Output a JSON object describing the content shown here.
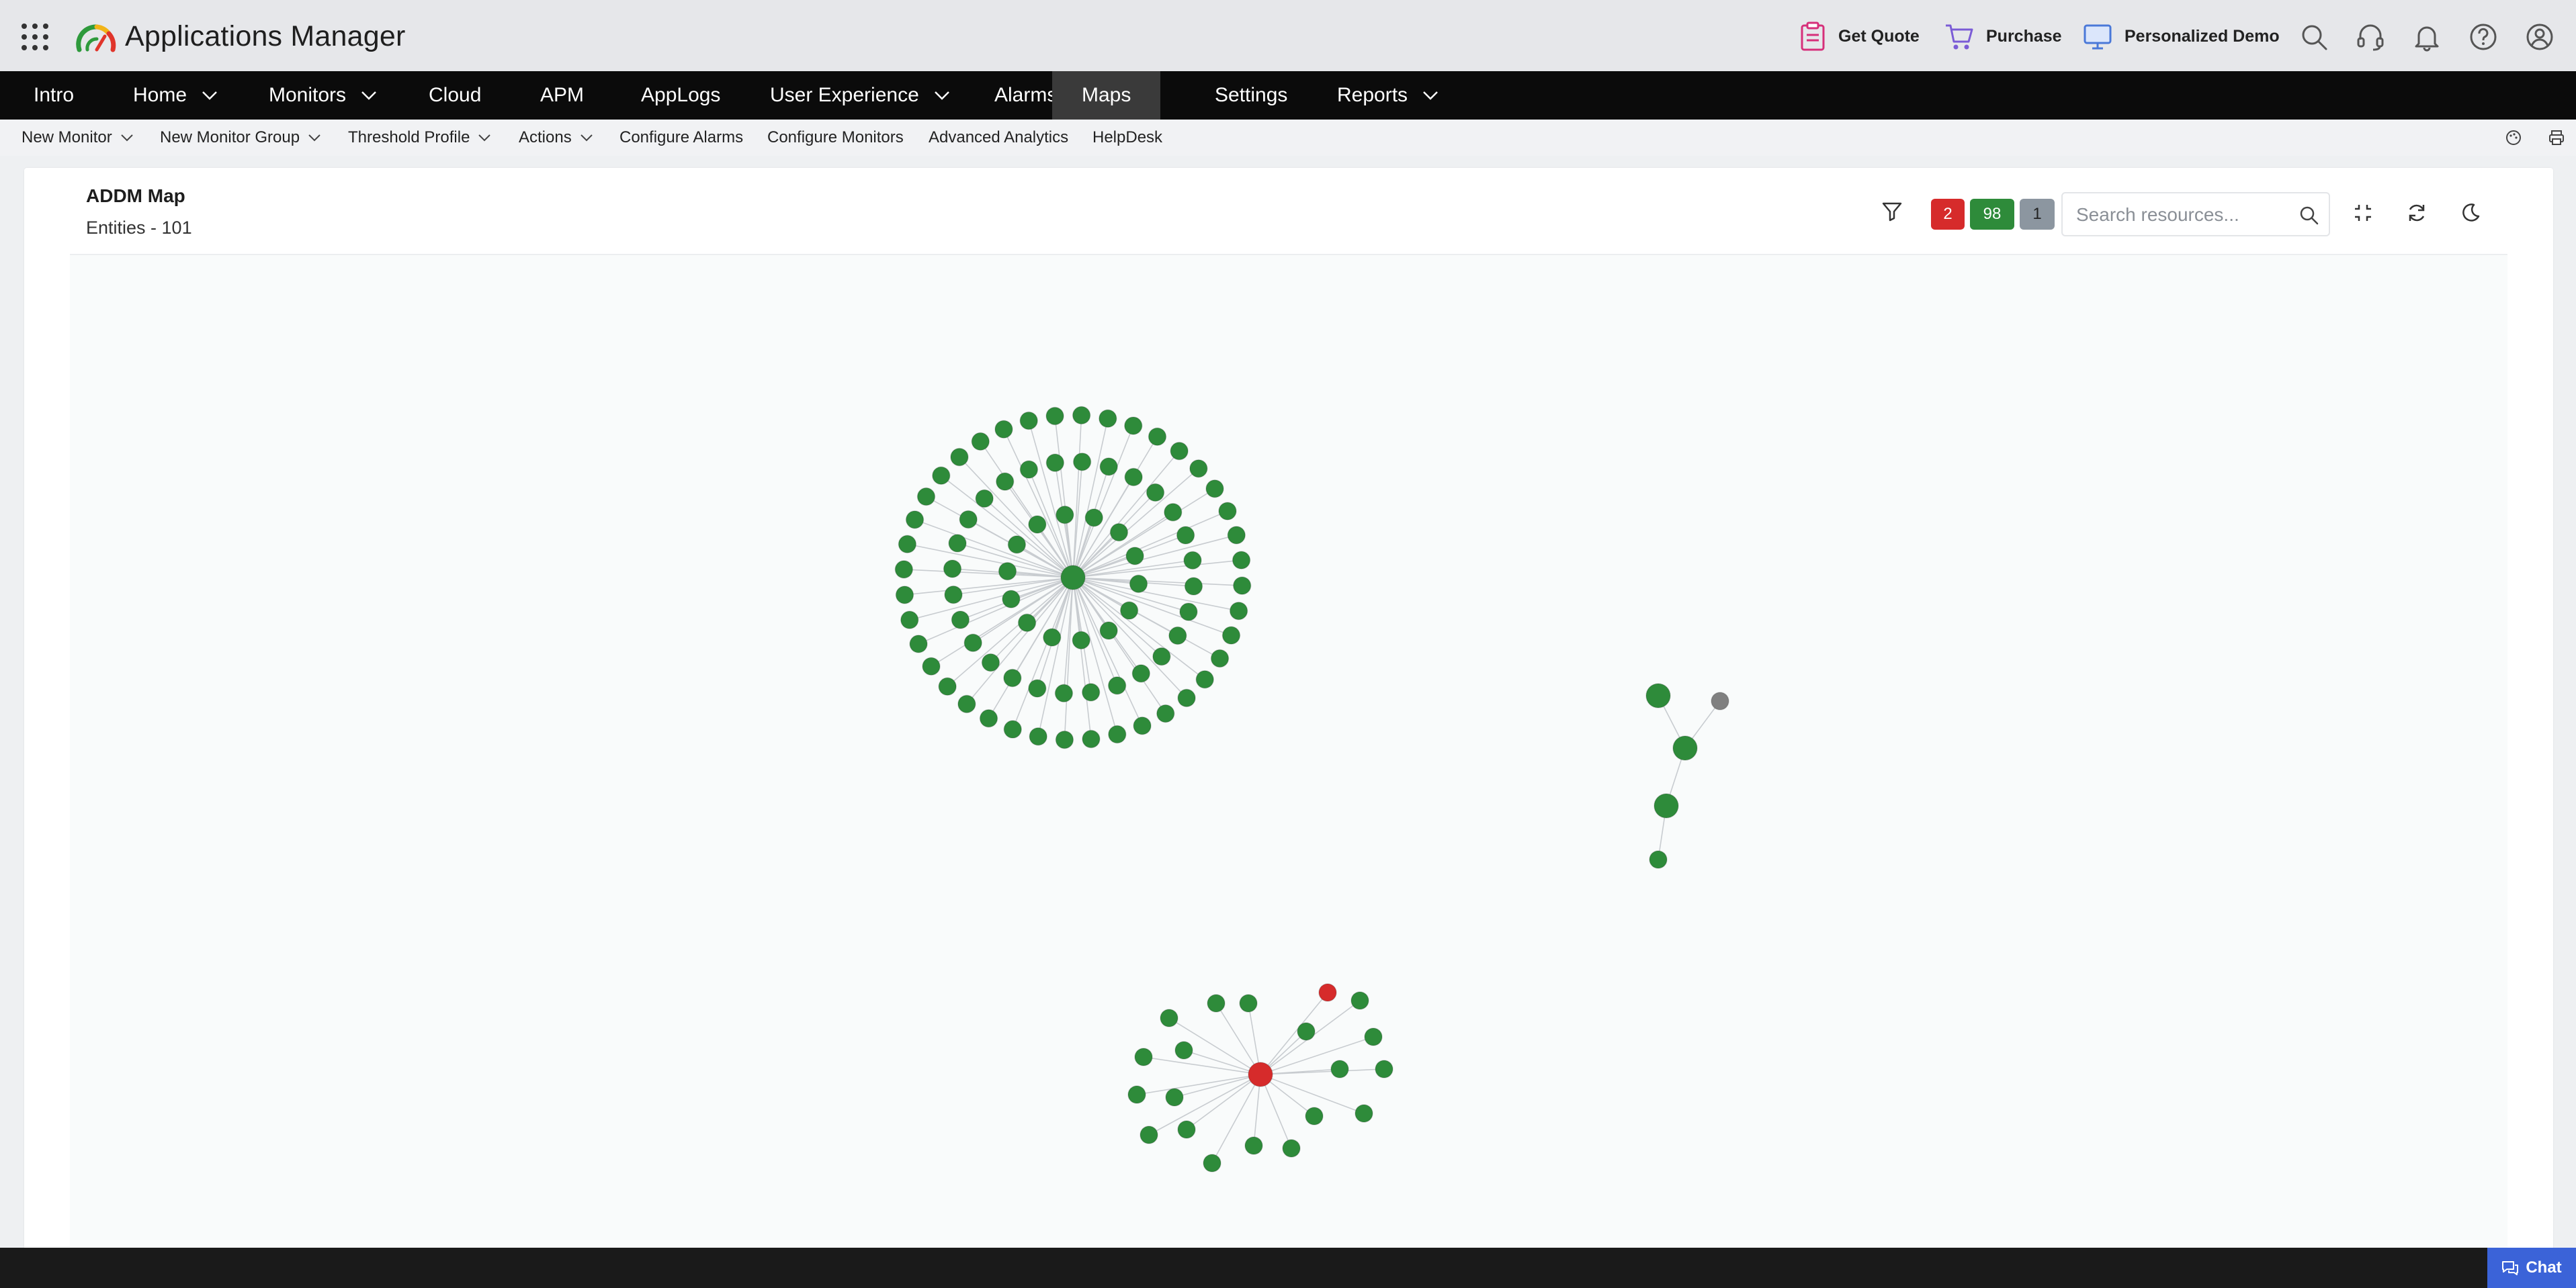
{
  "app": {
    "title": "Applications Manager",
    "grid_icon": "apps-grid-icon",
    "logo_icon": "gauge-logo-icon"
  },
  "top_actions": [
    {
      "label": "Get Quote",
      "icon": "clipboard-icon",
      "color": "#d62f7a"
    },
    {
      "label": "Purchase",
      "icon": "cart-icon",
      "color": "#7b5cd6"
    },
    {
      "label": "Personalized Demo",
      "icon": "monitor-icon",
      "color": "#4a78d8"
    }
  ],
  "top_icons": [
    "search-icon",
    "headset-icon",
    "bell-icon",
    "help-icon",
    "user-icon"
  ],
  "main_nav": [
    {
      "label": "Intro",
      "dropdown": false,
      "active": false
    },
    {
      "label": "Home",
      "dropdown": true,
      "active": false
    },
    {
      "label": "Monitors",
      "dropdown": true,
      "active": false
    },
    {
      "label": "Cloud",
      "dropdown": false,
      "active": false
    },
    {
      "label": "APM",
      "dropdown": false,
      "active": false
    },
    {
      "label": "AppLogs",
      "dropdown": false,
      "active": false
    },
    {
      "label": "User Experience",
      "dropdown": true,
      "active": false
    },
    {
      "label": "Alarms",
      "dropdown": false,
      "active": false
    },
    {
      "label": "Maps",
      "dropdown": false,
      "active": true
    },
    {
      "label": "Settings",
      "dropdown": false,
      "active": false
    },
    {
      "label": "Reports",
      "dropdown": true,
      "active": false
    }
  ],
  "sub_nav": [
    {
      "label": "New Monitor",
      "dropdown": true
    },
    {
      "label": "New Monitor Group",
      "dropdown": true
    },
    {
      "label": "Threshold Profile",
      "dropdown": true
    },
    {
      "label": "Actions",
      "dropdown": true
    },
    {
      "label": "Configure Alarms",
      "dropdown": false
    },
    {
      "label": "Configure Monitors",
      "dropdown": false
    },
    {
      "label": "Advanced Analytics",
      "dropdown": false
    },
    {
      "label": "HelpDesk",
      "dropdown": false
    }
  ],
  "sub_icons": [
    "palette-icon",
    "print-icon"
  ],
  "map": {
    "title": "ADDM Map",
    "entities_label": "Entities - 101",
    "status_counts": {
      "critical": "2",
      "clear": "98",
      "unknown": "1"
    },
    "search_placeholder": "Search resources...",
    "tools": [
      "filter-icon",
      "fit-screen-icon",
      "refresh-icon",
      "dark-mode-icon"
    ],
    "colors": {
      "clear": "#2e8b3a",
      "critical": "#d62b2b",
      "unknown": "#808080",
      "edge": "#c8ccd0"
    }
  },
  "chat": {
    "label": "Chat",
    "icon": "chat-icon"
  }
}
